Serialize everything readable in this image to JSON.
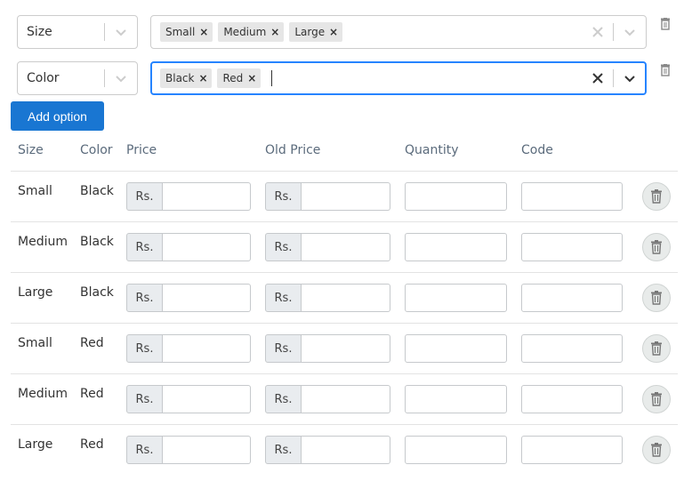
{
  "options": [
    {
      "name": "Size",
      "values": [
        "Small",
        "Medium",
        "Large"
      ],
      "focused": false
    },
    {
      "name": "Color",
      "values": [
        "Black",
        "Red"
      ],
      "focused": true
    }
  ],
  "add_option_label": "Add option",
  "table": {
    "headers": {
      "size": "Size",
      "color": "Color",
      "price": "Price",
      "old_price": "Old Price",
      "quantity": "Quantity",
      "code": "Code"
    },
    "currency_prefix": "Rs.",
    "rows": [
      {
        "size": "Small",
        "color": "Black"
      },
      {
        "size": "Medium",
        "color": "Black"
      },
      {
        "size": "Large",
        "color": "Black"
      },
      {
        "size": "Small",
        "color": "Red"
      },
      {
        "size": "Medium",
        "color": "Red"
      },
      {
        "size": "Large",
        "color": "Red"
      }
    ]
  },
  "icons": {
    "remove_chip": "remove-x-icon",
    "clear": "clear-icon",
    "dropdown": "chevron-down-icon",
    "delete": "trash-icon"
  },
  "colors": {
    "primary_button": "#1976d2",
    "focus_border": "#2684ff"
  }
}
